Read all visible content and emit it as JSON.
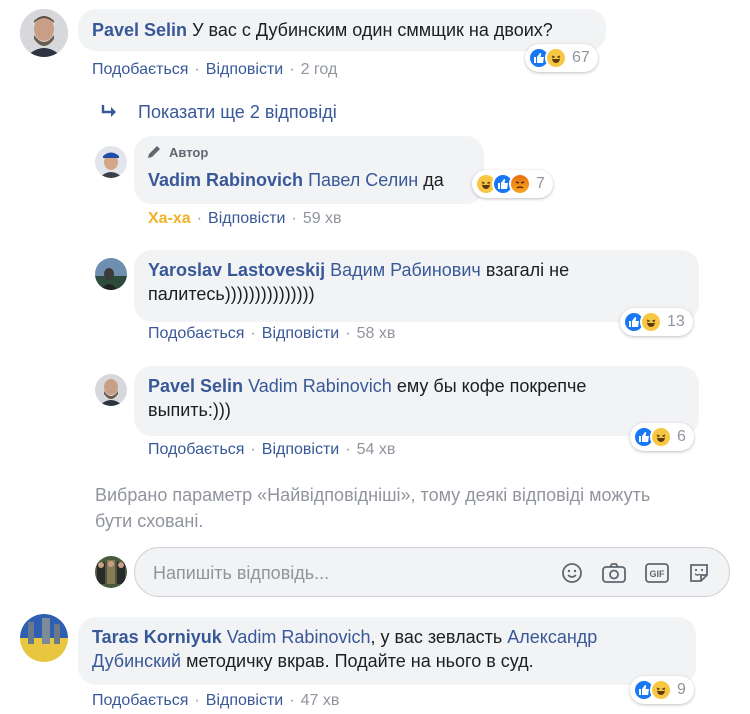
{
  "comment1": {
    "author": "Pavel Selin",
    "text": "У вас с Дубинским один сммщик на двоих?",
    "actions": {
      "like": "Подобається",
      "reply": "Відповісти",
      "time": "2 год"
    },
    "reaction_count": "67"
  },
  "show_more": {
    "label": "Показати ще 2 відповіді"
  },
  "reply1": {
    "badge": "Автор",
    "author": "Vadim Rabinovich",
    "mention": "Павел Селин",
    "text": "да",
    "actions": {
      "reaction_label": "Ха-ха",
      "reply": "Відповісти",
      "time": "59 хв"
    },
    "reaction_count": "7"
  },
  "reply2": {
    "author": "Yaroslav Lastoveskij",
    "mention": "Вадим Рабинович",
    "text_line1": "взагалі не",
    "text_line2": "палитесь)))))))))))))))",
    "actions": {
      "like": "Подобається",
      "reply": "Відповісти",
      "time": "58 хв"
    },
    "reaction_count": "13"
  },
  "reply3": {
    "author": "Pavel Selin",
    "mention": "Vadim Rabinovich",
    "text_line1": "ему бы кофе покрепче",
    "text_line2": "выпить:)))",
    "actions": {
      "like": "Подобається",
      "reply": "Відповісти",
      "time": "54 хв"
    },
    "reaction_count": "6"
  },
  "notice": {
    "line1": "Вибрано параметр «Найвідповідніші», тому деякі відповіді можуть",
    "line2": "бути сховані."
  },
  "reply_box": {
    "placeholder": "Напишіть відповідь...",
    "icons": [
      "emoji-icon",
      "camera-icon",
      "gif-icon",
      "sticker-icon"
    ]
  },
  "comment2": {
    "author": "Taras Korniyuk",
    "mention1": "Vadim Rabinovich",
    "text1": ", у вас зевласть",
    "mention2": "Александр Дубинский",
    "text2": "методичку вкрав. Подайте на нього в суд.",
    "actions": {
      "like": "Подобається",
      "reply": "Відповісти",
      "time": "47 хв"
    },
    "reaction_count": "9"
  },
  "colors": {
    "link": "#385898",
    "meta": "#90949c",
    "bubble": "#f2f3f5",
    "like": "#1877f2",
    "haha": "#f7c744",
    "haha_label": "#f0b327"
  }
}
